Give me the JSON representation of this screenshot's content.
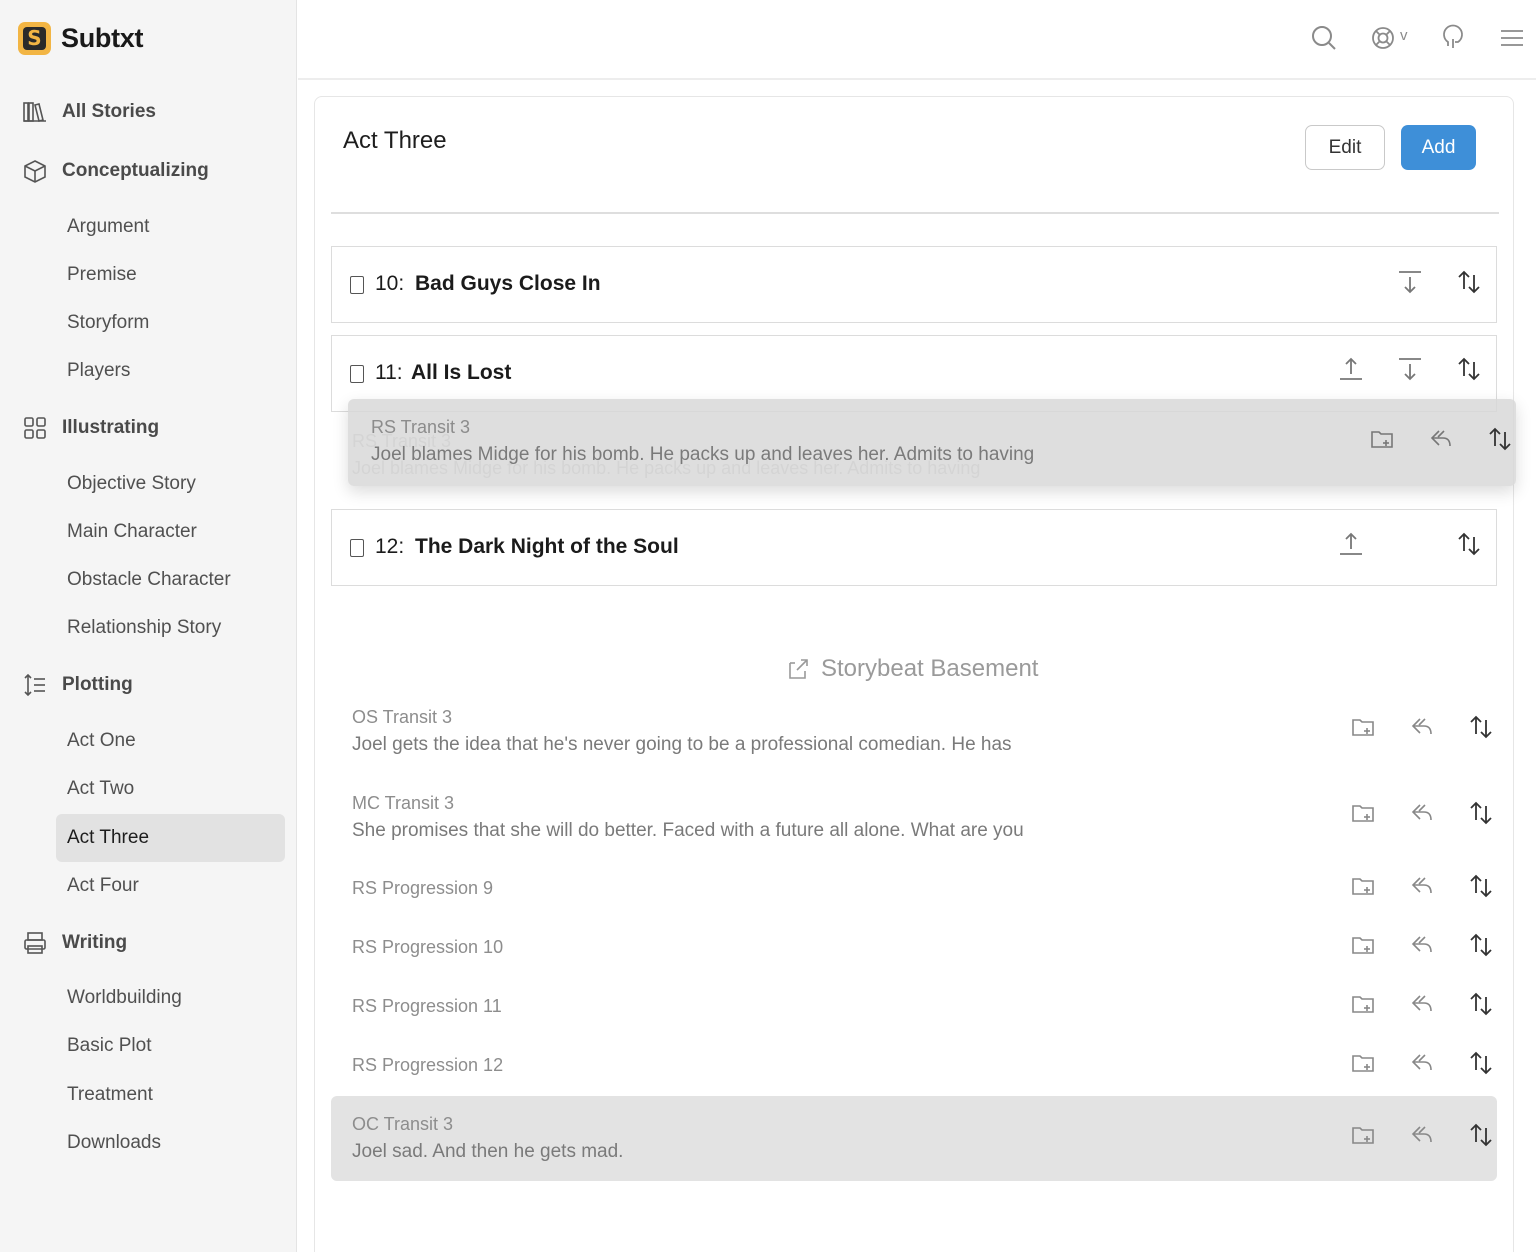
{
  "app": {
    "name": "Subtxt",
    "logo_letter": "S"
  },
  "sidebar": {
    "sections": [
      {
        "label": "All Stories",
        "icon": "library-icon"
      },
      {
        "label": "Conceptualizing",
        "icon": "cube-icon"
      },
      {
        "label": "Illustrating",
        "icon": "grid-icon"
      },
      {
        "label": "Plotting",
        "icon": "sort-lines-icon"
      },
      {
        "label": "Writing",
        "icon": "printer-icon"
      }
    ],
    "conceptualizing_items": [
      "Argument",
      "Premise",
      "Storyform",
      "Players"
    ],
    "illustrating_items": [
      "Objective Story",
      "Main Character",
      "Obstacle Character",
      "Relationship Story"
    ],
    "plotting_items": [
      "Act One",
      "Act Two",
      "Act Three",
      "Act Four"
    ],
    "writing_items": [
      "Worldbuilding",
      "Basic Plot",
      "Treatment",
      "Downloads"
    ],
    "active_item": "Act Three"
  },
  "topbar": {
    "icons": [
      "search-icon",
      "help-icon",
      "chevron-down-icon",
      "feedback-icon",
      "menu-icon"
    ],
    "help_caret": "v"
  },
  "page": {
    "title": "Act Three",
    "edit_label": "Edit",
    "add_label": "Add",
    "beats": [
      {
        "number": "10:",
        "title": "Bad Guys Close In"
      },
      {
        "number": "11:",
        "title": "All Is Lost"
      },
      {
        "number": "12:",
        "title": "The Dark Night of the Soul"
      }
    ],
    "dragging": {
      "title": "RS Transit 3",
      "text": "Joel blames Midge for his bomb. He packs up and leaves her. Admits to having"
    }
  },
  "basement": {
    "heading": "Storybeat Basement",
    "items": [
      {
        "title": "OS Transit 3",
        "text": "Joel gets the idea that he's never going to be a professional comedian. He has"
      },
      {
        "title": "MC Transit 3",
        "text": "She promises that she will do better. Faced with a future all alone. What are you"
      },
      {
        "title": "RS Progression 9",
        "text": ""
      },
      {
        "title": "RS Progression 10",
        "text": ""
      },
      {
        "title": "RS Progression 11",
        "text": ""
      },
      {
        "title": "RS Progression 12",
        "text": ""
      },
      {
        "title": "OC Transit 3",
        "text": "Joel sad. And then he gets mad."
      }
    ]
  },
  "colors": {
    "accent": "#3e8fd8",
    "logo": "#f2b544",
    "active_nav": "#e2e2e2"
  }
}
